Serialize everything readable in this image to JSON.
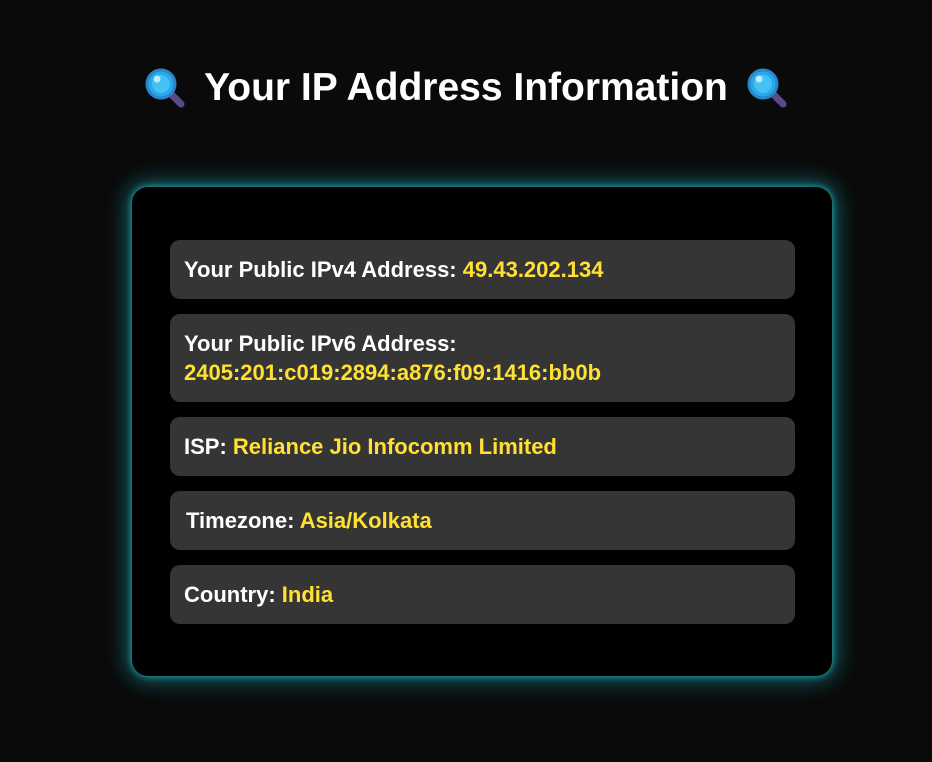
{
  "header": {
    "title": "Your IP Address Information",
    "icon": "magnifying-glass-icon"
  },
  "info": {
    "ipv4": {
      "label": "Your Public IPv4 Address:",
      "value": "49.43.202.134"
    },
    "ipv6": {
      "label": "Your Public IPv6 Address:",
      "value": "2405:201:c019:2894:a876:f09:1416:bb0b"
    },
    "isp": {
      "label": "ISP:",
      "value": "Reliance Jio Infocomm Limited"
    },
    "timezone": {
      "label": "Timezone:",
      "value": "Asia/Kolkata"
    },
    "country": {
      "label": "Country:",
      "value": "India"
    }
  },
  "colors": {
    "background": "#0a0a0a",
    "card": "#000000",
    "row": "#353535",
    "label": "#ffffff",
    "value": "#ffe033",
    "glow": "#20bec8"
  }
}
